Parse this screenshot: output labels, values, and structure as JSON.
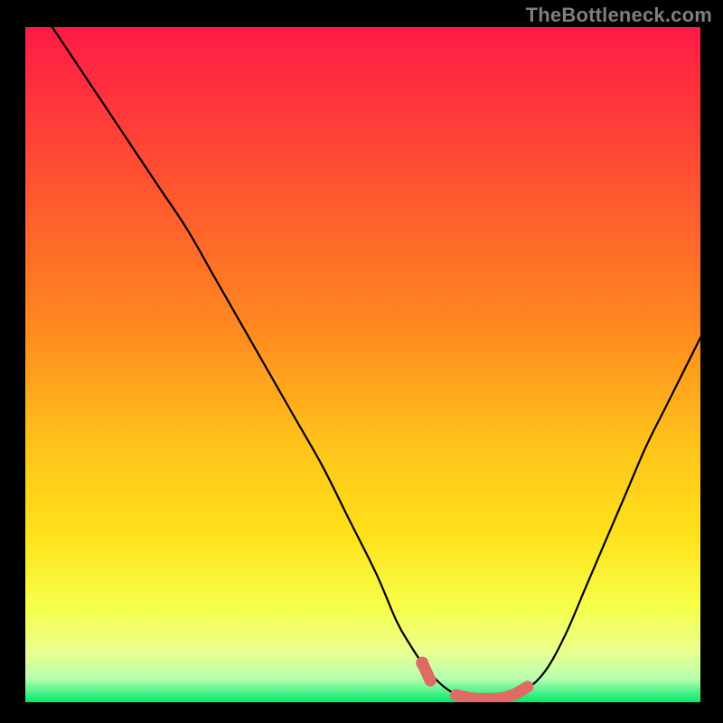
{
  "attribution": "TheBottleneck.com",
  "colors": {
    "gradient_top": "#ff1a46",
    "gradient_mid1": "#ff8a1f",
    "gradient_mid2": "#ffe11a",
    "gradient_mid3": "#f6ff4a",
    "gradient_mid4": "#e9ff8f",
    "gradient_bottom": "#00e86b",
    "curve": "#000000",
    "highlight": "#e06a64"
  },
  "chart_data": {
    "type": "line",
    "title": "",
    "xlabel": "",
    "ylabel": "",
    "xlim": [
      0,
      100
    ],
    "ylim": [
      0,
      100
    ],
    "x": [
      4.0,
      8.0,
      12.0,
      16.0,
      20.0,
      24.0,
      28.0,
      32.0,
      36.0,
      40.0,
      44.0,
      48.0,
      52.0,
      55.0,
      57.0,
      59.0,
      61.0,
      63.0,
      65.0,
      67.0,
      69.0,
      71.0,
      74.0,
      77.0,
      80.0,
      83.0,
      86.0,
      89.0,
      92.0,
      95.0,
      98.0,
      100.0
    ],
    "values": [
      100.0,
      94.0,
      88.0,
      82.0,
      76.0,
      70.0,
      63.0,
      56.0,
      49.0,
      42.0,
      35.0,
      27.0,
      19.0,
      12.0,
      8.5,
      5.5,
      3.2,
      1.6,
      0.8,
      0.5,
      0.5,
      0.7,
      1.8,
      4.6,
      10.0,
      17.0,
      24.0,
      31.0,
      38.0,
      44.0,
      50.0,
      54.0
    ],
    "highlight_segments": [
      {
        "x": [
          58.8,
          60.0
        ],
        "y": [
          5.8,
          3.2
        ]
      },
      {
        "x": [
          63.8,
          65.0,
          66.0,
          67.0,
          68.0,
          69.0,
          70.0,
          71.0,
          72.5,
          74.4
        ],
        "y": [
          1.05,
          0.8,
          0.6,
          0.5,
          0.48,
          0.5,
          0.56,
          0.7,
          1.2,
          2.3
        ]
      }
    ]
  }
}
